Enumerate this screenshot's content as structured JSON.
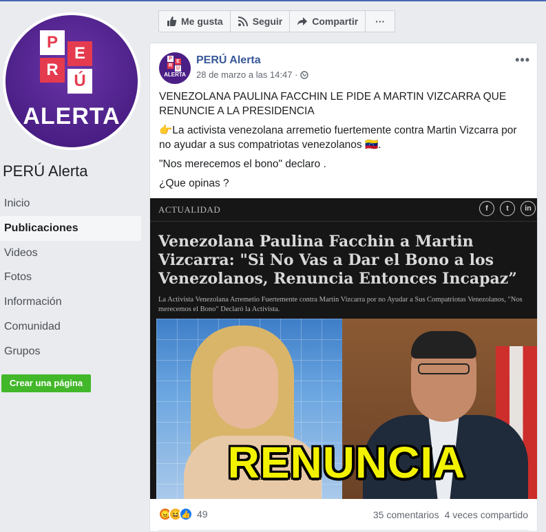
{
  "colors": {
    "brand_blue": "#4267b2",
    "link_blue": "#385898",
    "green": "#42b72a",
    "logo_purple": "#4b1f86",
    "logo_red": "#e53b4e",
    "banner_yellow": "#f2f200"
  },
  "sidebar": {
    "logo_letters": [
      "P",
      "E",
      "R",
      "Ú"
    ],
    "logo_word": "ALERTA",
    "page_name": "PERÚ Alerta",
    "items": [
      {
        "label": "Inicio",
        "active": false
      },
      {
        "label": "Publicaciones",
        "active": true
      },
      {
        "label": "Videos",
        "active": false
      },
      {
        "label": "Fotos",
        "active": false
      },
      {
        "label": "Información",
        "active": false
      },
      {
        "label": "Comunidad",
        "active": false
      },
      {
        "label": "Grupos",
        "active": false
      }
    ],
    "create_page_label": "Crear una página"
  },
  "actionbar": {
    "like_label": "Me gusta",
    "follow_label": "Seguir",
    "share_label": "Compartir",
    "more_label": "···"
  },
  "post": {
    "author": "PERÚ Alerta",
    "timestamp": "28 de marzo a las 14:47 ·",
    "more_label": "•••",
    "headline": "VENEZOLANA PAULINA FACCHIN LE PIDE A MARTIN VIZCARRA QUE RENUNCIE A LA PRESIDENCIA",
    "paragraph1": "👉La activista venezolana arremetio fuertemente contra Martin Vizcarra por no ayudar a sus compatriotas venezolanos 🇻🇪.",
    "paragraph2": "\"Nos merecemos el bono\" declaro .",
    "paragraph3": "¿Que opinas ?",
    "shared": {
      "category": "ACTUALIDAD",
      "social_icons": [
        "f",
        "t",
        "in"
      ],
      "title": "Venezolana Paulina Facchin a Martin Vizcarra: \"Si No Vas a Dar el Bono a los Venezolanos, Renuncia Entonces Incapaz”",
      "subtitle": "La Activista Venezolana Arremetio Fuertemente contra Martin Vizcarra por no Ayudar a Sus Compatriotas Venezolanos, \"Nos merecemos el Bono\" Declaró la Activista.",
      "banner": "RENUNCIA"
    },
    "reactions": {
      "icons": [
        "angry-icon",
        "haha-icon",
        "like-icon"
      ],
      "count": "49"
    },
    "comments": "35 comentarios",
    "shares": "4 veces compartido"
  }
}
